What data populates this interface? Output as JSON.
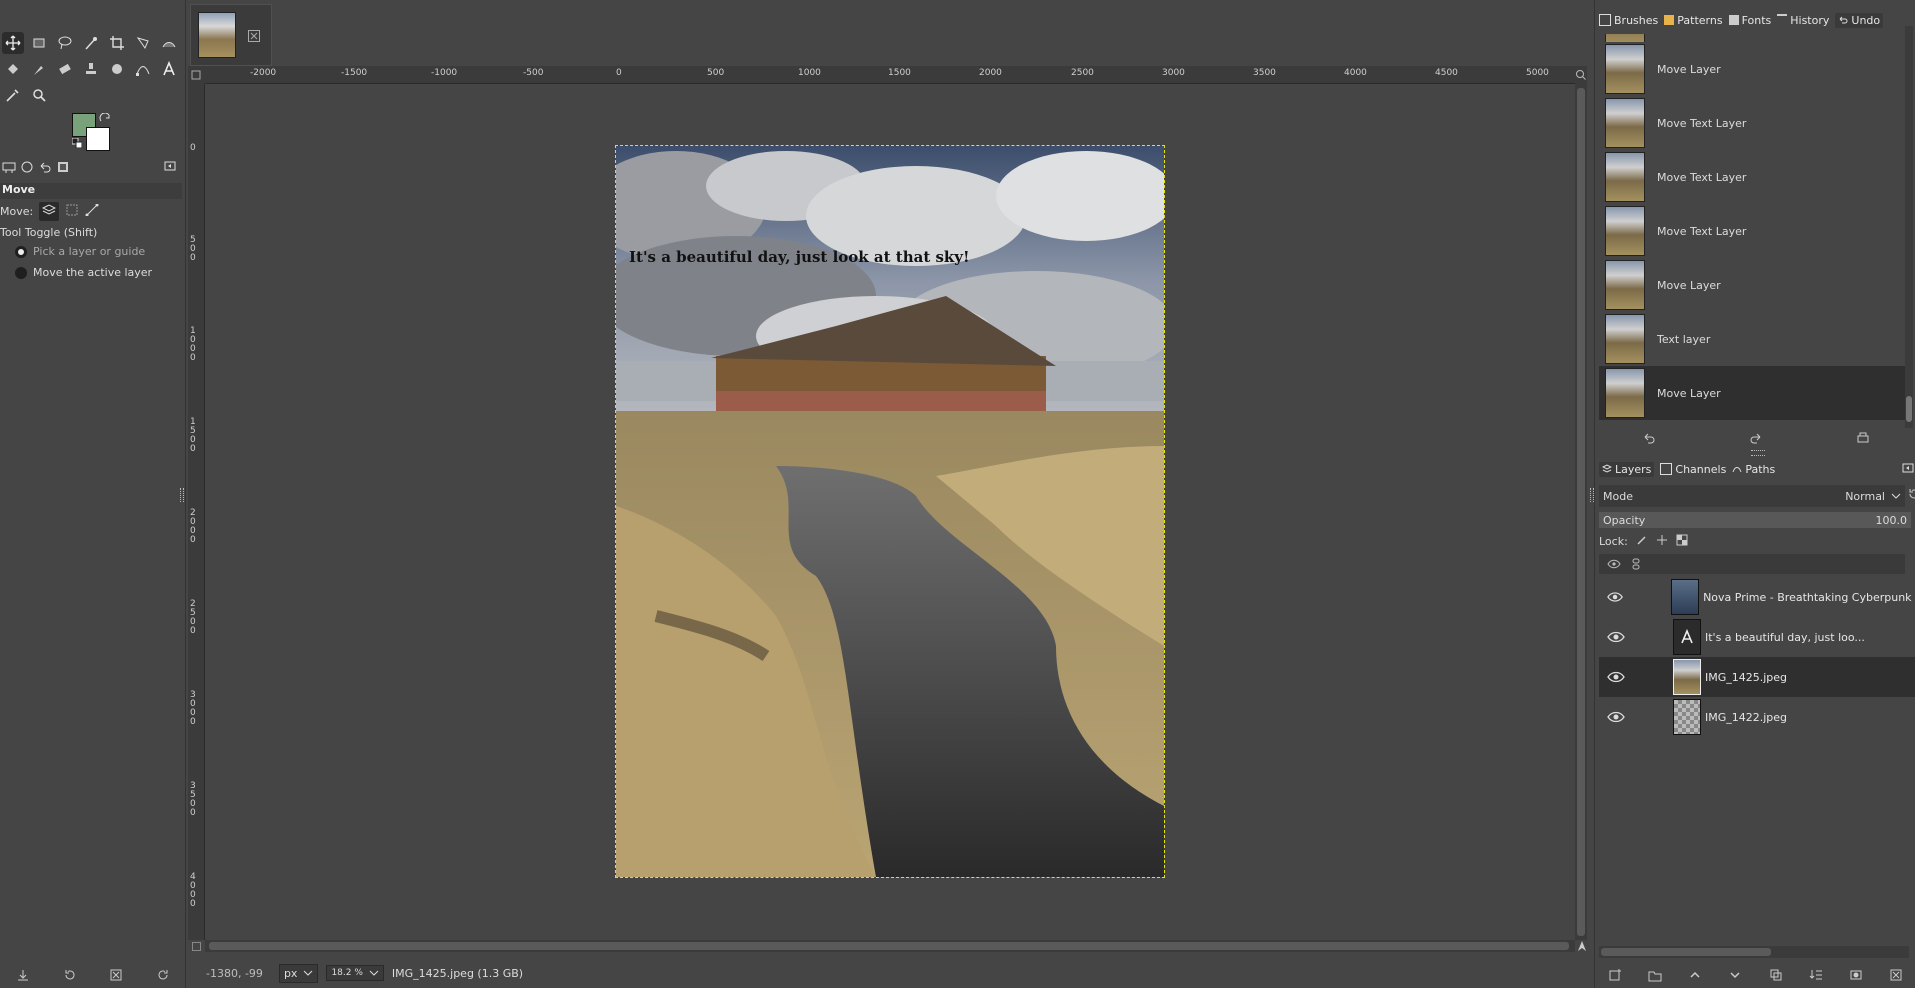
{
  "toolbox": {
    "tool_options_title": "Move",
    "move_label": "Move:",
    "tool_toggle_label": "Tool Toggle  (Shift)",
    "option_pick": "Pick a layer or guide",
    "option_active": "Move the active layer",
    "selected_option": "Pick a layer or guide",
    "fg_color": "#7aa27a",
    "bg_color": "#ffffff"
  },
  "canvas": {
    "caption": "It's a beautiful day, just look at that sky!",
    "hruler_labels": [
      "-2000",
      "-1500",
      "-1000",
      "-500",
      "0",
      "500",
      "1000",
      "1500",
      "2000",
      "2500",
      "3000",
      "3500",
      "4000",
      "4500",
      "5000"
    ],
    "vruler_labels": [
      "0",
      "500",
      "1000",
      "1500",
      "2000",
      "2500",
      "3000",
      "3500",
      "4000"
    ]
  },
  "statusbar": {
    "coords": "-1380, -99",
    "unit": "px",
    "zoom": "18.2 %",
    "file_info": "IMG_1425.jpeg (1.3 GB)"
  },
  "dock": {
    "top_tabs": [
      "Brushes",
      "Patterns",
      "Fonts",
      "History",
      "Undo"
    ],
    "selected_top_tab": "Undo",
    "history": [
      "Move Layer",
      "Move Text Layer",
      "Move Text Layer",
      "Move Text Layer",
      "Move Layer",
      "Text layer",
      "Move Layer"
    ],
    "layer_tabs": [
      "Layers",
      "Channels",
      "Paths"
    ],
    "mode_label": "Mode",
    "mode_value": "Normal",
    "opacity_label": "Opacity",
    "opacity_value": "100.0",
    "lock_label": "Lock:",
    "layers": [
      {
        "name": "Nova Prime - Breathtaking Cyberpunk Amb"
      },
      {
        "name": "It's a beautiful day, just loo..."
      },
      {
        "name": "IMG_1425.jpeg"
      },
      {
        "name": "IMG_1422.jpeg"
      }
    ],
    "selected_layer": "IMG_1425.jpeg"
  }
}
